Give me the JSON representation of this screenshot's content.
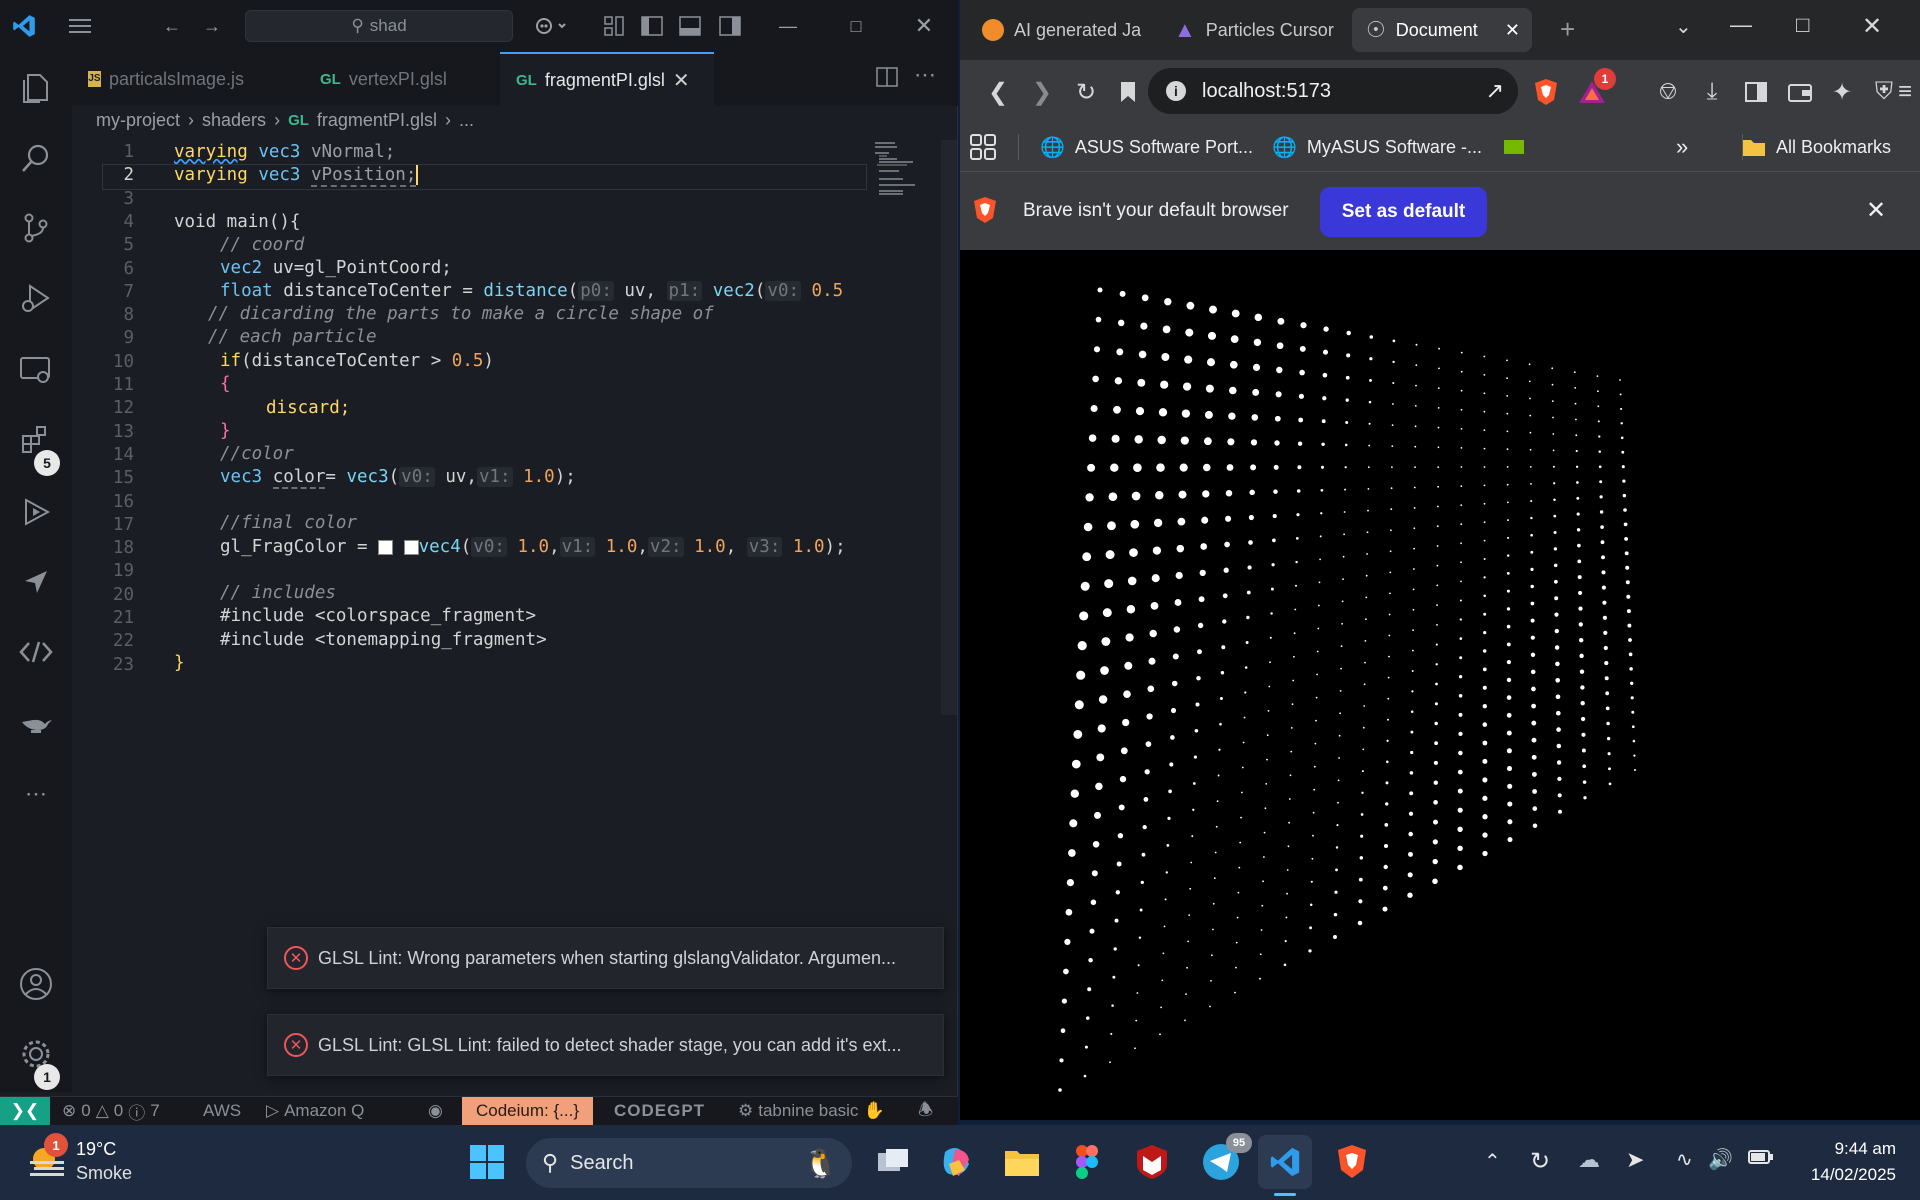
{
  "vscode": {
    "search_text": "shad",
    "tabs": [
      {
        "icon": "JS",
        "label": "particalsImage.js"
      },
      {
        "icon": "GL",
        "label": "vertexPI.glsl"
      },
      {
        "icon": "GL",
        "label": "fragmentPI.glsl"
      }
    ],
    "breadcrumb": {
      "project": "my-project",
      "folder": "shaders",
      "file_icon": "GL",
      "file": "fragmentPI.glsl",
      "more": "..."
    },
    "line_numbers": [
      "1",
      "2",
      "3",
      "4",
      "5",
      "6",
      "7",
      "8",
      "9",
      "10",
      "11",
      "12",
      "13",
      "14",
      "15",
      "16",
      "17",
      "18",
      "19",
      "20",
      "21",
      "22",
      "23"
    ],
    "code": {
      "l1_kw": "varying",
      "l1_ty": "vec3",
      "l1_var": "vNormal;",
      "l2_kw": "varying",
      "l2_ty": "vec3",
      "l2_var": "vPosition;",
      "l4": "void main(){",
      "l5": "// coord",
      "l6_ty": "vec2",
      "l6_rest": " uv=gl_PointCoord;",
      "l7_ty": "float",
      "l7_var": " distanceToCenter = ",
      "l7_fn": "distance",
      "l7_h1": "p0:",
      "l7_a1": " uv, ",
      "l7_h2": "p1:",
      "l7_fn2": "vec2",
      "l7_h3": "v0:",
      "l7_n": " 0.5",
      "l8": "// dicarding the parts to make a circle shape of",
      "l9": "// each particle",
      "l10_kw": "if",
      "l10_rest": "(distanceToCenter > ",
      "l10_num": "0.5",
      "l10_end": ")",
      "l11": "{",
      "l12": "discard;",
      "l13": "}",
      "l14": "//color",
      "l15_ty": "vec3",
      "l15_var": "color",
      "l15_eq": "= ",
      "l15_fn": "vec3",
      "l15_h1": "v0:",
      "l15_a1": " uv,",
      "l15_h2": "v1:",
      "l15_n": " 1.0",
      "l15_end": ");",
      "l17": "//final color",
      "l18_var": "gl_FragColor = ",
      "l18_fn": "vec4",
      "l18_h0": "v0:",
      "l18_n0": " 1.0",
      "l18_h1": "v1:",
      "l18_n1": " 1.0",
      "l18_h2": "v2:",
      "l18_n2": " 1.0",
      "l18_h3": "v3:",
      "l18_n3": " 1.0",
      "l18_end": ");",
      "l20": "// includes",
      "l21": "#include <colorspace_fragment>",
      "l22": "#include <tonemapping_fragment>",
      "l23": "}"
    },
    "notifications": [
      "GLSL Lint: Wrong parameters when starting glslangValidator. Argumen...",
      "GLSL Lint: GLSL Lint: failed to detect shader stage, you can add it's ext..."
    ],
    "activity_badges": {
      "extensions": "5",
      "settings": "1"
    },
    "status": {
      "errors": "0",
      "warnings": "0",
      "info": "7",
      "aws": "AWS",
      "amazonq": "Amazon Q",
      "codeium": "Codeium: {...}",
      "codegpt": "CODEGPT",
      "tabnine": "tabnine basic"
    }
  },
  "browser": {
    "tabs": [
      {
        "label": "AI generated Ja"
      },
      {
        "label": "Particles Cursor"
      },
      {
        "label": "Document"
      }
    ],
    "url": "localhost:5173",
    "bookmarks": [
      "ASUS Software Port...",
      "MyASUS Software -...",
      "All Bookmarks"
    ],
    "rewards_badge": "1",
    "infobar_text": "Brave isn't your default browser",
    "set_default_label": "Set as default"
  },
  "taskbar": {
    "weather_temp": "19°C",
    "weather_desc": "Smoke",
    "weather_badge": "1",
    "search_label": "Search",
    "telegram_badge": "95",
    "time": "9:44 am",
    "date": "14/02/2025"
  },
  "colors": {
    "accent_blue": "#3fa0ff",
    "brave_button": "#3b38d9",
    "error_red": "#f0575b",
    "codeium_bg": "#f0a07a"
  }
}
